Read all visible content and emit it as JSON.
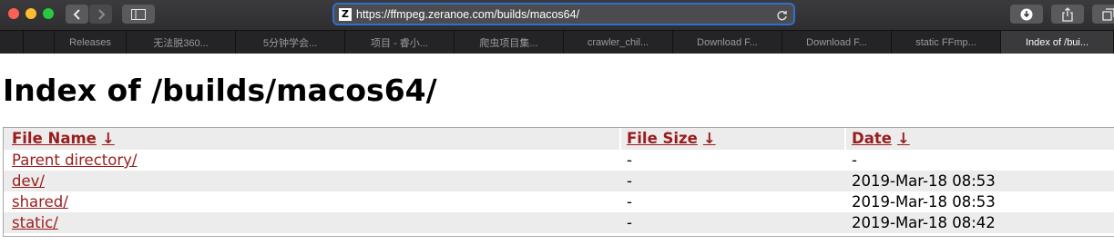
{
  "browser": {
    "url": "https://ffmpeg.zeranoe.com/builds/macos64/",
    "favicon_letter": "Z",
    "tabs": [
      "Releases",
      "无法脱360...",
      "5分钟学会...",
      "项目 - 睿小...",
      "爬虫项目集...",
      "crawler_chil...",
      "Download F...",
      "Download F...",
      "static FFmp...",
      "Index of /bui..."
    ],
    "active_tab_index": 9
  },
  "page": {
    "title": "Index of /builds/macos64/",
    "columns": {
      "name": "File Name",
      "size": "File Size",
      "date": "Date",
      "sort_arrow": "↓"
    },
    "rows": [
      {
        "name": "Parent directory/",
        "size": "-",
        "date": "-"
      },
      {
        "name": "dev/",
        "size": "-",
        "date": "2019-Mar-18 08:53"
      },
      {
        "name": "shared/",
        "size": "-",
        "date": "2019-Mar-18 08:53"
      },
      {
        "name": "static/",
        "size": "-",
        "date": "2019-Mar-18 08:42"
      }
    ]
  },
  "colors": {
    "link": "#9a1c1c",
    "toolbar": "#3b3b3d",
    "address_focus": "#2f6fd0"
  }
}
